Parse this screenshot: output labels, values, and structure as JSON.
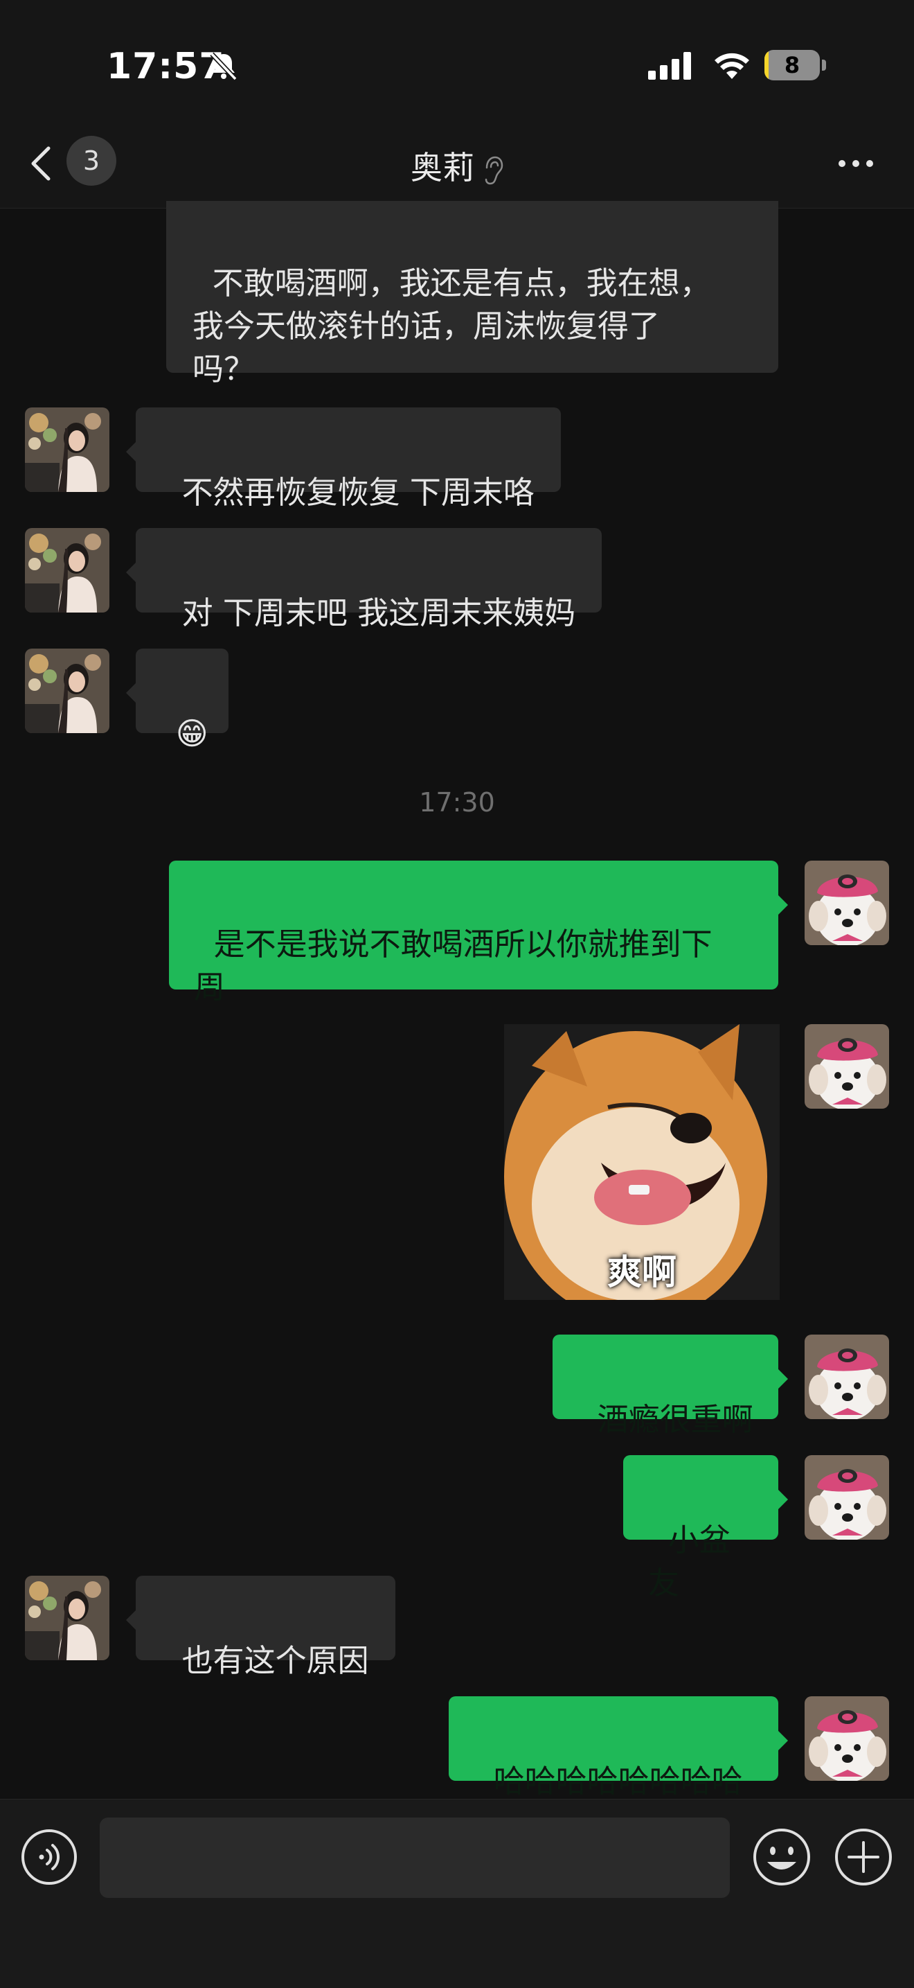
{
  "status_bar": {
    "time": "17:57",
    "battery": "8",
    "battery_level": 0.08
  },
  "nav": {
    "back_count": "3",
    "title": "奥莉"
  },
  "messages": [
    {
      "side": "in",
      "text": "不敢喝酒啊，我还是有点，我在想，\n我今天做滚针的话，周沫恢复得了\n吗？"
    },
    {
      "side": "in",
      "text": "不然再恢复恢复 下周末咯"
    },
    {
      "side": "in",
      "text": "对 下周末吧 我这周末来姨妈"
    },
    {
      "side": "in",
      "text": "😁"
    },
    {
      "side": "out",
      "text": "是不是我说不敢喝酒所以你就推到下\n周"
    },
    {
      "side": "out",
      "type": "sticker",
      "caption": "爽啊"
    },
    {
      "side": "out",
      "text": "酒瘾很重啊"
    },
    {
      "side": "out",
      "text": "小盆友"
    },
    {
      "side": "in",
      "text": "也有这个原因"
    },
    {
      "side": "out",
      "text": "哈哈哈哈哈哈哈哈"
    }
  ],
  "timestamp": "17:30",
  "input": {
    "value": "",
    "placeholder": ""
  },
  "colors": {
    "background": "#111111",
    "incoming_bubble": "#2b2b2b",
    "outgoing_bubble": "#1fb958",
    "battery": "#f5d52a"
  }
}
